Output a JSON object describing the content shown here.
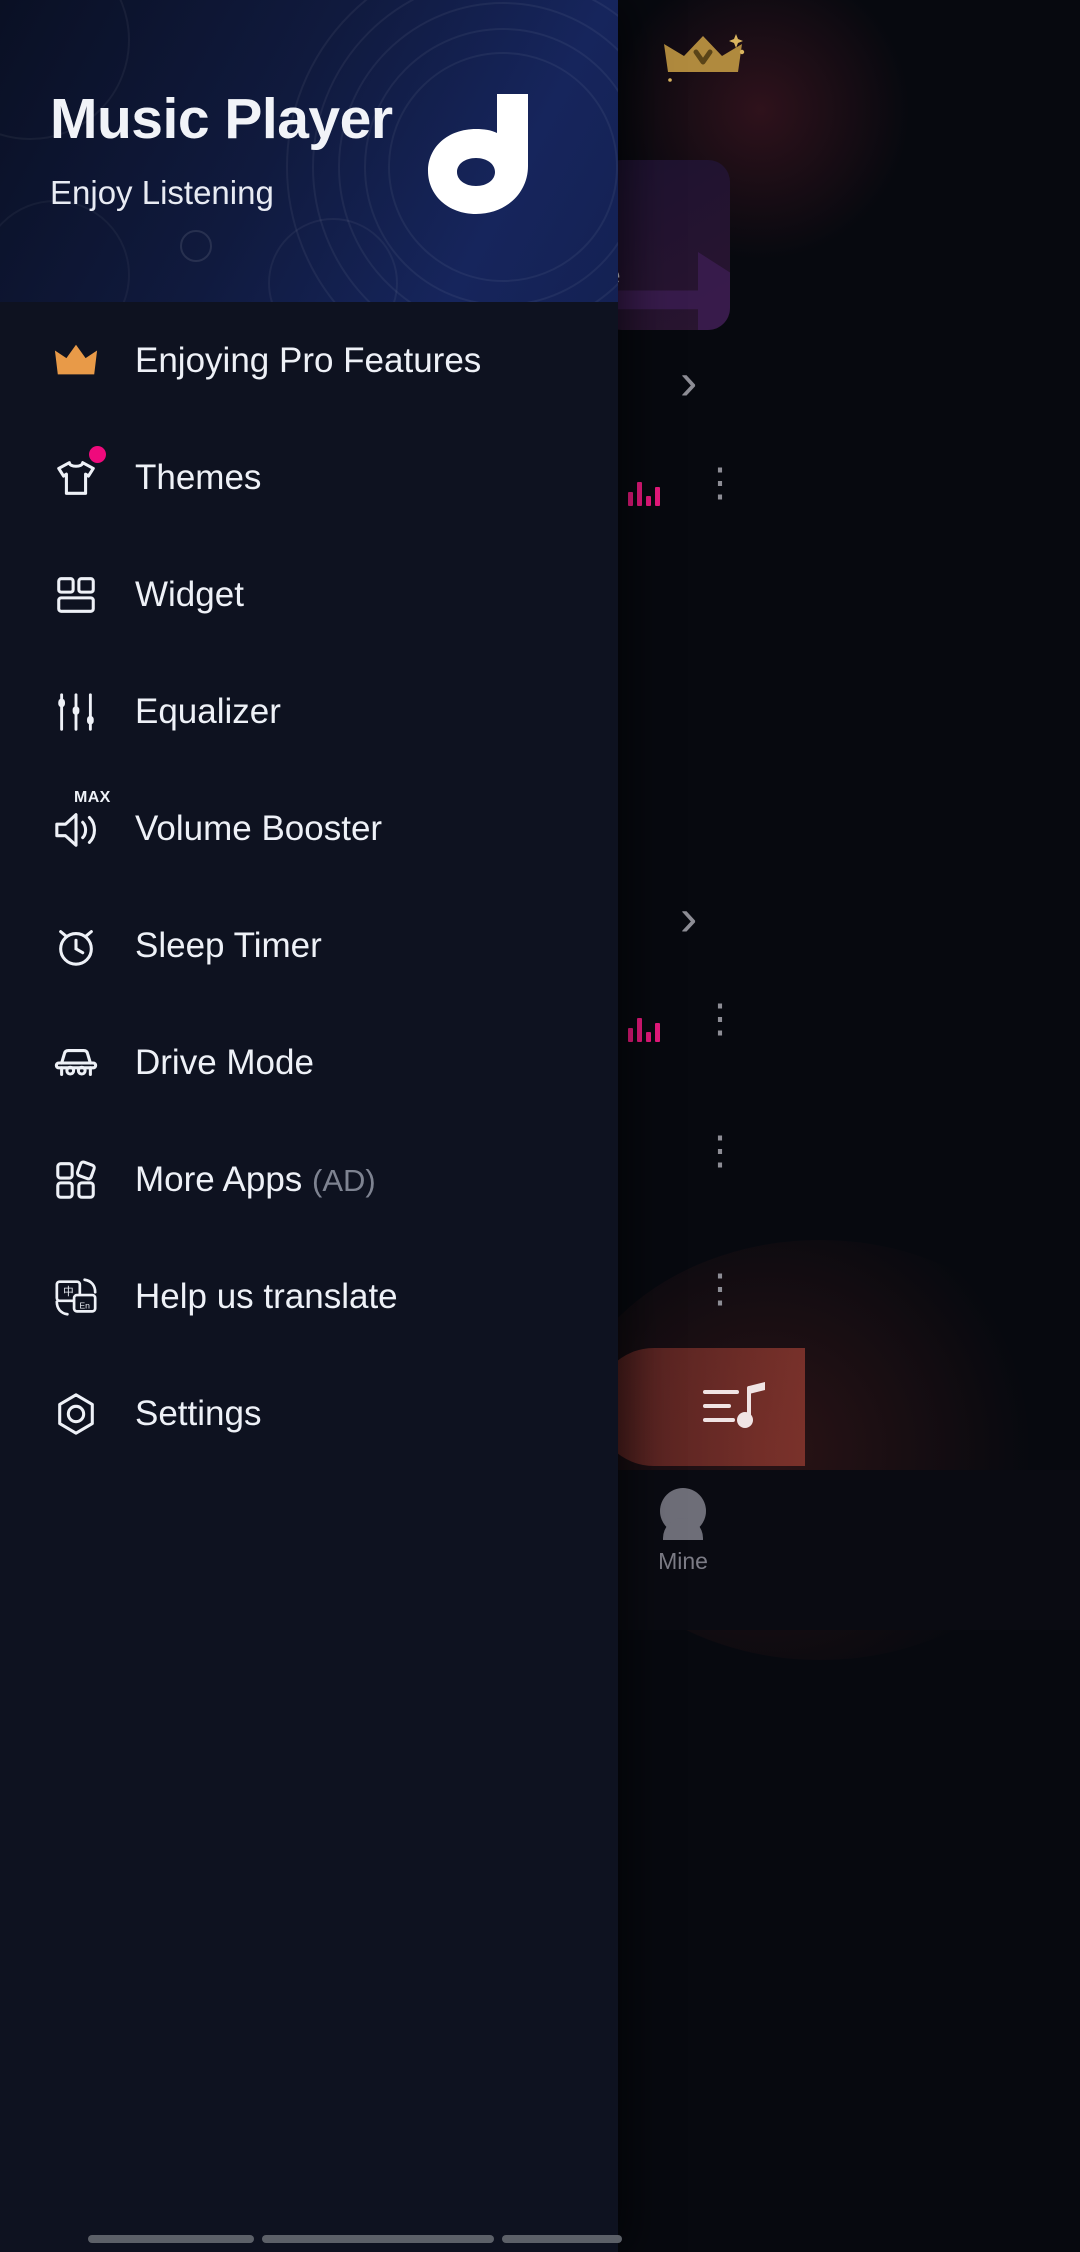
{
  "drawer": {
    "header": {
      "title": "Music Player",
      "subtitle": "Enjoy Listening",
      "logo_icon": "music-note-icon"
    },
    "items": [
      {
        "label": "Enjoying Pro Features",
        "icon": "crown-icon",
        "badge": false,
        "ad": ""
      },
      {
        "label": "Themes",
        "icon": "tshirt-icon",
        "badge": true,
        "ad": ""
      },
      {
        "label": "Widget",
        "icon": "widget-grid-icon",
        "badge": false,
        "ad": ""
      },
      {
        "label": "Equalizer",
        "icon": "equalizer-icon",
        "badge": false,
        "ad": ""
      },
      {
        "label": "Volume Booster",
        "icon": "volume-max-icon",
        "badge": false,
        "ad": "",
        "icon_tag": "MAX"
      },
      {
        "label": "Sleep Timer",
        "icon": "alarm-clock-icon",
        "badge": false,
        "ad": ""
      },
      {
        "label": "Drive Mode",
        "icon": "car-icon",
        "badge": false,
        "ad": ""
      },
      {
        "label": "More Apps",
        "icon": "apps-grid-icon",
        "badge": false,
        "ad": "(AD)"
      },
      {
        "label": "Help us translate",
        "icon": "translate-icon",
        "badge": false,
        "ad": ""
      },
      {
        "label": "Settings",
        "icon": "settings-gear-icon",
        "badge": false,
        "ad": ""
      }
    ]
  },
  "background": {
    "pro_crown_icon": "crown-premium-icon",
    "promo_card_label": "e",
    "chevron_icon": "chevron-right-icon",
    "overflow_icon": "more-vertical-icon",
    "equalizer_playing_icon": "equalizer-bars-icon",
    "mini_player_icon": "playlist-note-icon",
    "nav": {
      "label": "Mine",
      "icon": "person-icon"
    }
  },
  "colors": {
    "drawer_bg": "#0e1220",
    "header_gradient_start": "#0a1024",
    "header_gradient_end": "#142153",
    "crown_orange": "#e89a48",
    "badge_pink": "#ef0a7c",
    "accent_pink": "#e8197d",
    "text_primary": "#eef1f7",
    "text_muted": "#7e8391"
  },
  "translate_icon_text": {
    "source": "中",
    "target": "En"
  }
}
